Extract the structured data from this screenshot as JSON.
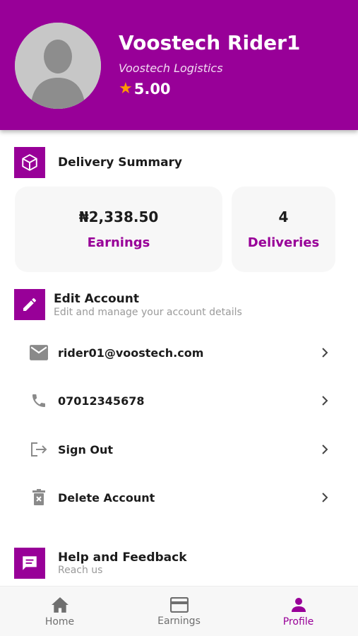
{
  "profile": {
    "name": "Voostech Rider1",
    "company": "Voostech Logistics",
    "rating": "5.00",
    "star_color": "#ff9800"
  },
  "theme": {
    "accent": "#980098",
    "accent_light": "#f3dcf3",
    "muted_text": "#9a9a9a"
  },
  "delivery_summary": {
    "title": "Delivery Summary",
    "icon": "package-icon",
    "cards": [
      {
        "value": "₦2,338.50",
        "label": "Earnings"
      },
      {
        "value": "4",
        "label": "Deliveries"
      }
    ]
  },
  "edit_account": {
    "title": "Edit Account",
    "subtitle": "Edit and manage your account details",
    "icon": "pencil-icon",
    "items": [
      {
        "label": "rider01@voostech.com",
        "icon": "email-icon"
      },
      {
        "label": "07012345678",
        "icon": "phone-icon"
      },
      {
        "label": "Sign Out",
        "icon": "logout-icon"
      },
      {
        "label": "Delete Account",
        "icon": "trash-icon"
      }
    ]
  },
  "help": {
    "title": "Help and Feedback",
    "subtitle": "Reach us",
    "icon": "feedback-icon"
  },
  "bottom_nav": {
    "active": "Profile",
    "items": [
      {
        "label": "Home",
        "icon": "home-icon"
      },
      {
        "label": "Earnings",
        "icon": "card-icon"
      },
      {
        "label": "Profile",
        "icon": "person-icon"
      }
    ]
  }
}
